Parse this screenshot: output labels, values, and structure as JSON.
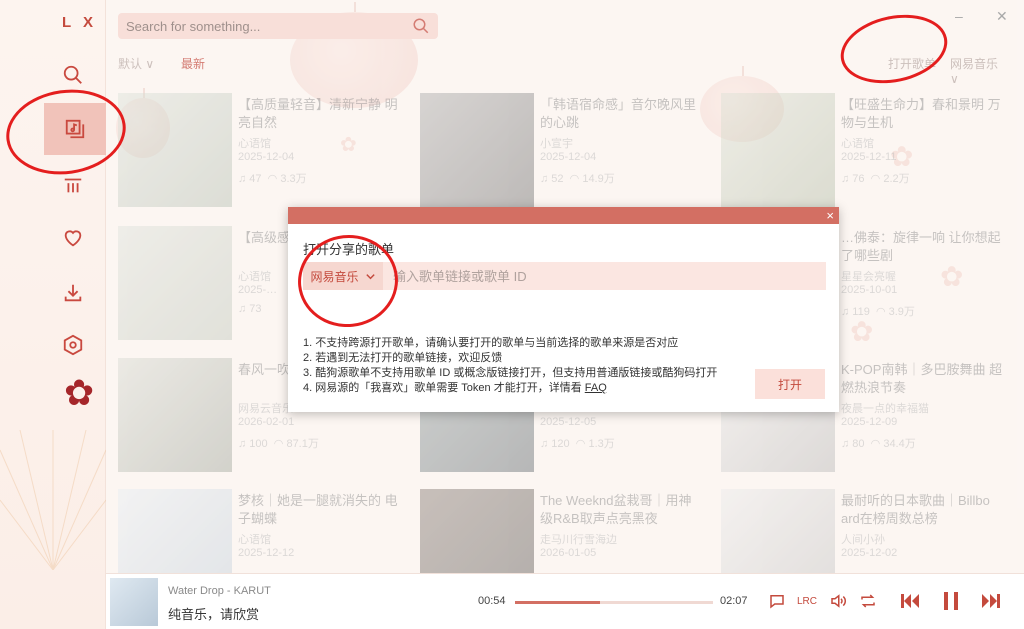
{
  "app": {
    "logo": "L X"
  },
  "search": {
    "placeholder": "Search for something..."
  },
  "subbar": {
    "sort_default": "默认 ∨",
    "sort_latest": "最新",
    "open_playlist": "打开歌单",
    "source": "网易音乐 ∨"
  },
  "cards": [
    {
      "title": "【高质量轻音】清新宁静 明亮自然",
      "author": "心语馆",
      "date": "2025-12-04",
      "plays": "♫ 47",
      "listens": "◠ 3.3万"
    },
    {
      "title": "「韩语宿命感」音尔晚风里 的心跳",
      "author": "小宣宇",
      "date": "2025-12-04",
      "plays": "♫ 52",
      "listens": "◠ 14.9万"
    },
    {
      "title": "【旺盛生命力】春和景明 万物与生机",
      "author": "心语馆",
      "date": "2025-12-11",
      "plays": "♫ 76",
      "listens": "◠ 2.2万"
    },
    {
      "title": "【高级感】… 万物生长",
      "author": "心语馆",
      "date": "2025-…",
      "plays": "♫ 73",
      "listens": ""
    },
    {
      "title": "",
      "author": "",
      "date": "",
      "plays": "",
      "listens": ""
    },
    {
      "title": "…佛泰：旋律一响 让你想起了哪些剧",
      "author": "星星会亮喔",
      "date": "2025-10-01",
      "plays": "♫ 119",
      "listens": "◠ 3.9万"
    },
    {
      "title": "春风一吹… 同",
      "author": "网易云音乐",
      "date": "2026-02-01",
      "plays": "♫ 100",
      "listens": "◠ 87.1万"
    },
    {
      "title": "",
      "author": "",
      "date": "2025-12-05",
      "plays": "♫ 120",
      "listens": "◠ 1.3万"
    },
    {
      "title": "K-POP南韩｜多巴胺舞曲 超燃热浪节奏",
      "author": "夜晨一点的幸福猫",
      "date": "2025-12-09",
      "plays": "♫ 80",
      "listens": "◠ 34.4万"
    },
    {
      "title": "梦核｜她是一腿就消失的 电子蝴蝶",
      "author": "心语馆",
      "date": "2025-12-12",
      "plays": "",
      "listens": ""
    },
    {
      "title": "The Weeknd盆栽哥｜用神 级R&B取声点亮黑夜",
      "author": "走马川行雪海边",
      "date": "2026-01-05",
      "plays": "",
      "listens": ""
    },
    {
      "title": "最耐听的日本歌曲｜Billbo ard在榜周数总榜",
      "author": "人间小孙",
      "date": "2025-12-02",
      "plays": "",
      "listens": ""
    }
  ],
  "modal": {
    "close": "×",
    "title": "打开分享的歌单",
    "source": "网易音乐",
    "input_placeholder": "输入歌单链接或歌单 ID",
    "tips": [
      "1. 不支持跨源打开歌单，请确认要打开的歌单与当前选择的歌单来源是否对应",
      "2. 若遇到无法打开的歌单链接，欢迎反馈",
      "3. 酷狗源歌单不支持用歌单 ID 或概念版链接打开，但支持用普通版链接或酷狗码打开",
      "4. 网易源的「我喜欢」歌单需要 Token 才能打开，详情看 "
    ],
    "faq": "FAQ",
    "open_button": "打开"
  },
  "player": {
    "song": "Water Drop - KARUT",
    "lyric": "纯音乐，请欣赏",
    "current_time": "00:54",
    "total_time": "02:07",
    "progress": 0.43,
    "lrc": "LRC"
  },
  "window": {
    "minimize": "–",
    "close": "✕"
  },
  "colors": {
    "accent": "#c44a3d",
    "modal_header": "#d36f63",
    "annotation": "#e41e1e"
  }
}
